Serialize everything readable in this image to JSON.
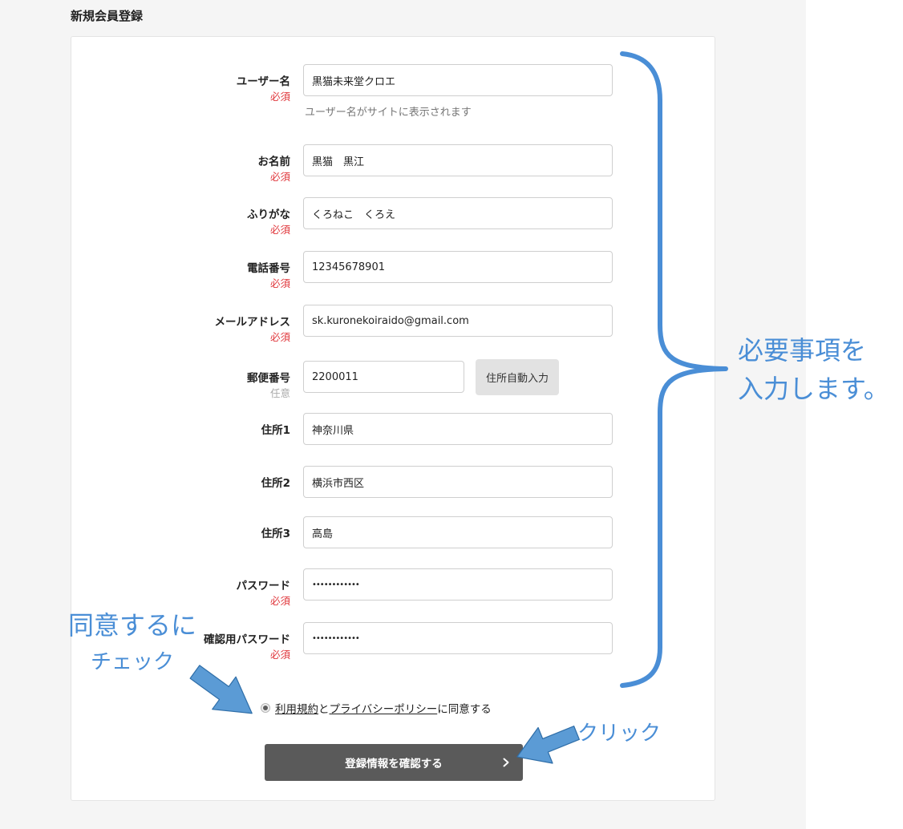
{
  "page": {
    "title": "新規会員登録"
  },
  "form": {
    "fields": [
      {
        "label": "ユーザー名",
        "requirement": "必須",
        "value": "黒猫未来堂クロエ",
        "help": "ユーザー名がサイトに表示されます"
      },
      {
        "label": "お名前",
        "requirement": "必須",
        "value": "黒猫　黒江"
      },
      {
        "label": "ふりがな",
        "requirement": "必須",
        "value": "くろねこ　くろえ"
      },
      {
        "label": "電話番号",
        "requirement": "必須",
        "value": "12345678901"
      },
      {
        "label": "メールアドレス",
        "requirement": "必須",
        "value": "sk.kuronekoiraido@gmail.com"
      },
      {
        "label": "郵便番号",
        "requirement": "任意",
        "value": "2200011"
      },
      {
        "label": "住所1",
        "value": "神奈川県"
      },
      {
        "label": "住所2",
        "value": "横浜市西区"
      },
      {
        "label": "住所3",
        "value": "高島"
      },
      {
        "label": "パスワード",
        "requirement": "必須",
        "value": "••••••••••••"
      },
      {
        "label": "確認用パスワード",
        "requirement": "必須",
        "value": "••••••••••••"
      }
    ],
    "zip_lookup_button": "住所自動入力",
    "agreement": {
      "checked": true,
      "terms_link": "利用規約",
      "connector": "と",
      "privacy_link": "プライバシーポリシー",
      "suffix": "に同意する"
    },
    "submit": {
      "label": "登録情報を確認する",
      "icon": "chevron-right-icon"
    }
  },
  "annotations": {
    "brace_note": {
      "line1": "必要事項を",
      "line2": "入力します。"
    },
    "agree_note": {
      "line1": "同意するに",
      "line2": "チェック"
    },
    "click_note": "クリック",
    "brace_icon": "curly-brace-icon",
    "agree_arrow_icon": "arrow-icon",
    "click_arrow_icon": "arrow-icon"
  },
  "colors": {
    "required": "#e0393e",
    "optional": "#aaaaaa",
    "submit_bg": "#5a5a5a",
    "annotation": "#4a8ed6",
    "page_bg": "#f5f5f5"
  }
}
